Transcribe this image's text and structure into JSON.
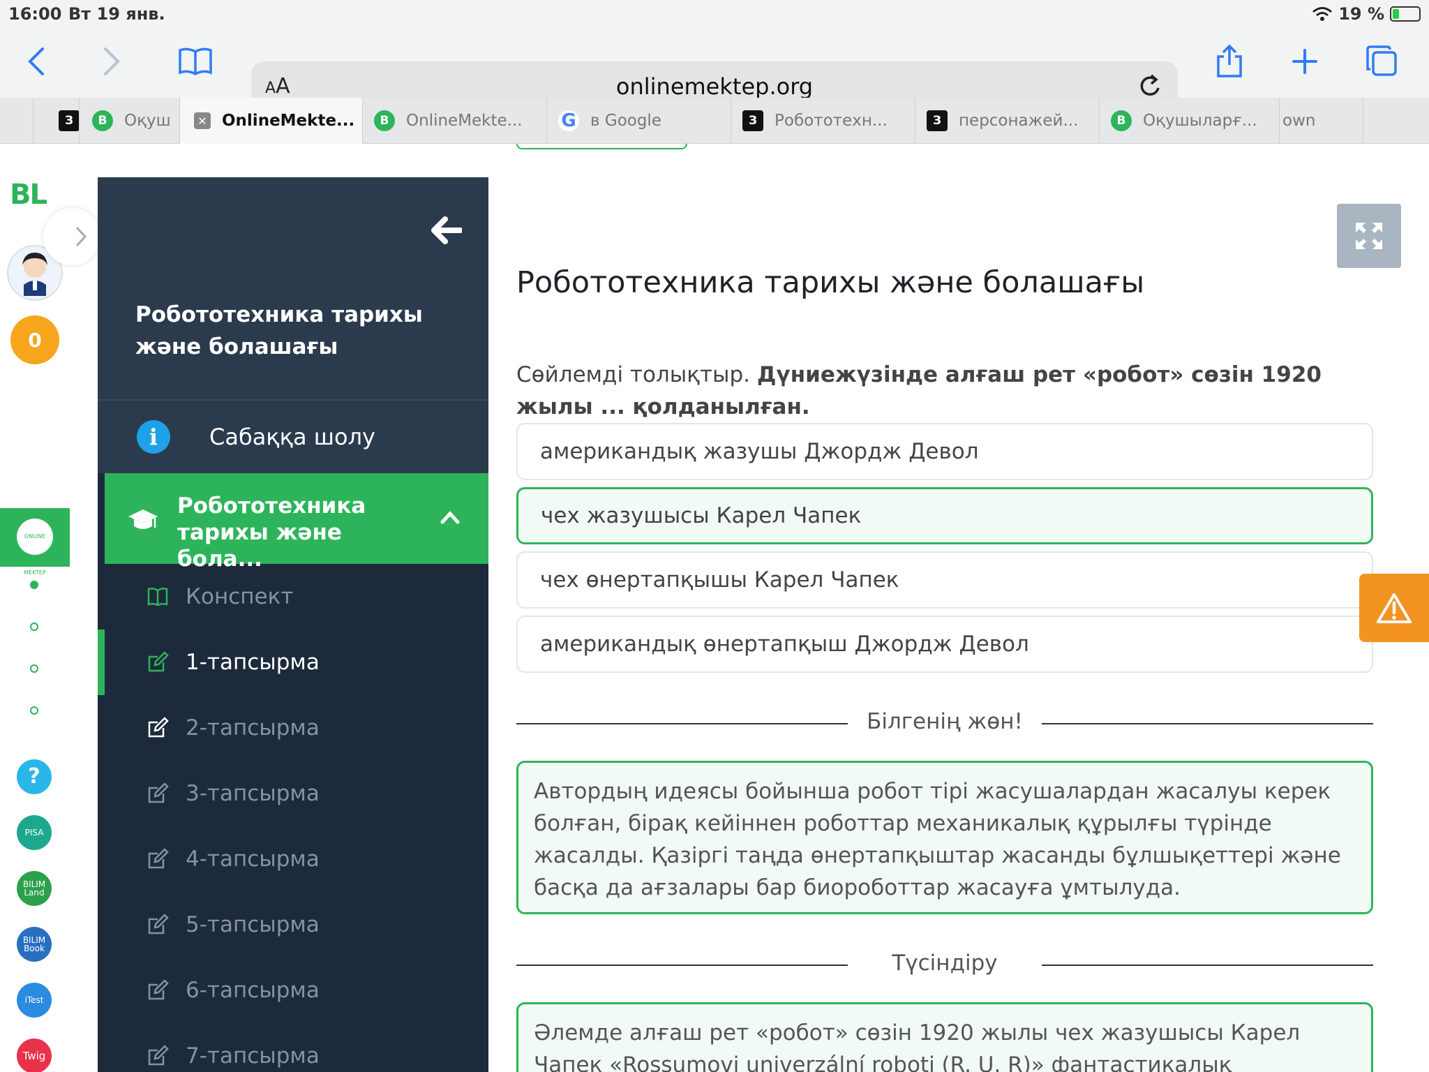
{
  "status": {
    "time": "16:00",
    "date": "Вт 19 янв.",
    "battery": "19 %"
  },
  "browser": {
    "aa_small": "A",
    "aa_big": "A",
    "url": "onlinemektep.org",
    "tabs": [
      {
        "icon": "З",
        "label": ""
      },
      {
        "icon": "B",
        "label": "Оқуш"
      },
      {
        "icon": "✕",
        "label": "OnlineMekte..."
      },
      {
        "icon": "B",
        "label": "OnlineMekte..."
      },
      {
        "icon": "G",
        "label": "в Google"
      },
      {
        "icon": "З",
        "label": "Робототехн..."
      },
      {
        "icon": "З",
        "label": "персонажей..."
      },
      {
        "icon": "B",
        "label": "Оқушыларғ..."
      },
      {
        "icon": "",
        "label": "own"
      }
    ]
  },
  "rail": {
    "logo": "BL",
    "coins": "0",
    "om_label": "ONLINE MEKTEP",
    "help": "?",
    "badges": [
      "PISA",
      "BILIM Land",
      "BILIM Book",
      "iTest",
      "Twig"
    ]
  },
  "sidebar": {
    "lesson_title": "Робототехника тарихы және болашағы",
    "overview_label": "Сабаққа шолу",
    "section_label": "Робототехника тарихы және бола...",
    "items": [
      "Конспект",
      "1-тапсырма",
      "2-тапсырма",
      "3-тапсырма",
      "4-тапсырма",
      "5-тапсырма",
      "6-тапсырма",
      "7-тапсырма"
    ]
  },
  "main": {
    "title": "Робототехника тарихы және болашағы",
    "question_prefix": "Сөйлемді толықтыр.",
    "question_bold": "Дүниежүзінде алғаш рет «робот» сөзін 1920 жылы ... қолданылған.",
    "options": [
      "американдық жазушы Джордж Девол",
      "чех жазушысы Карел Чапек",
      "чех өнертапқышы Карел Чапек",
      "американдық өнертапқыш Джордж Девол"
    ],
    "correct_index": 1,
    "know_heading": "Білгенің жөн!",
    "know_text": "Автордың идеясы бойынша робот тірі жасушалардан жасалуы керек болған, бірақ кейіннен роботтар механикалық құрылғы түрінде жасалды. Қазіргі таңда өнертапқыштар жасанды бұлшықеттері және басқа да ағзалары бар биороботтар жасауға ұмтылуда.",
    "explain_heading": "Түсіндіру",
    "explain_text": "Әлемде алғаш рет «робот» сөзін 1920 жылы чех жазушысы Карел Чапек «Rossumovi univerzální roboti (R. U. R)» фантастикалық пьесасында"
  },
  "colors": {
    "accent": "#2db45a",
    "sidebar": "#1d2a3b",
    "warning": "#f39321"
  }
}
